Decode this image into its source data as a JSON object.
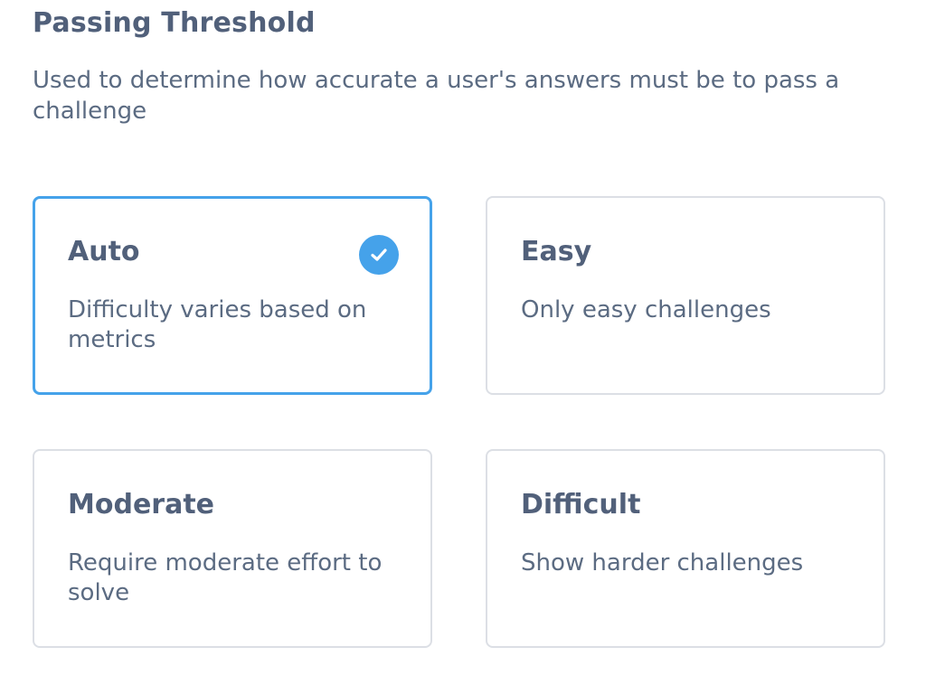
{
  "section": {
    "title": "Passing Threshold",
    "description": "Used to determine how accurate a user's answers must be to pass a challenge"
  },
  "options": [
    {
      "title": "Auto",
      "description": "Difficulty varies based on metrics",
      "selected": true
    },
    {
      "title": "Easy",
      "description": "Only easy challenges",
      "selected": false
    },
    {
      "title": "Moderate",
      "description": "Require moderate effort to solve",
      "selected": false
    },
    {
      "title": "Difficult",
      "description": "Show harder challenges",
      "selected": false
    }
  ],
  "colors": {
    "accent": "#45a2ea",
    "card_border": "#dcdfe5",
    "heading": "#51607a",
    "body_text": "#5b6b82"
  },
  "icons": {
    "selected": "check-circle-icon"
  }
}
